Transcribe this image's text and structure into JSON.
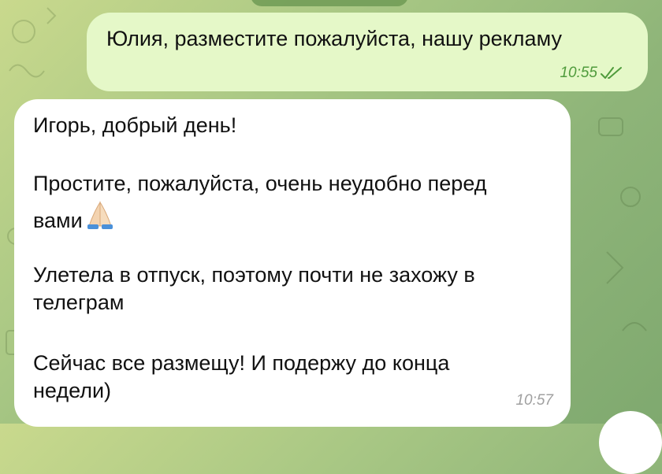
{
  "outgoing": {
    "text": "Юлия, разместите пожалуйста, нашу рекламу",
    "time": "10:55",
    "status_icon": "double-check-icon"
  },
  "incoming": {
    "lines": {
      "l1": "Игорь, добрый день!",
      "l2": "Простите, пожалуйста, очень неудобно перед",
      "l3": "вами",
      "l4": "Улетела в отпуск, поэтому почти не захожу в",
      "l5": "телеграм",
      "l6": "Сейчас все размещу! И подержу до конца",
      "l7": "недели)"
    },
    "emoji": "praying-hands-icon",
    "time": "10:57"
  },
  "colors": {
    "outgoing_bubble": "#e5f8c8",
    "incoming_bubble": "#ffffff",
    "check_color": "#4f9b3c"
  }
}
